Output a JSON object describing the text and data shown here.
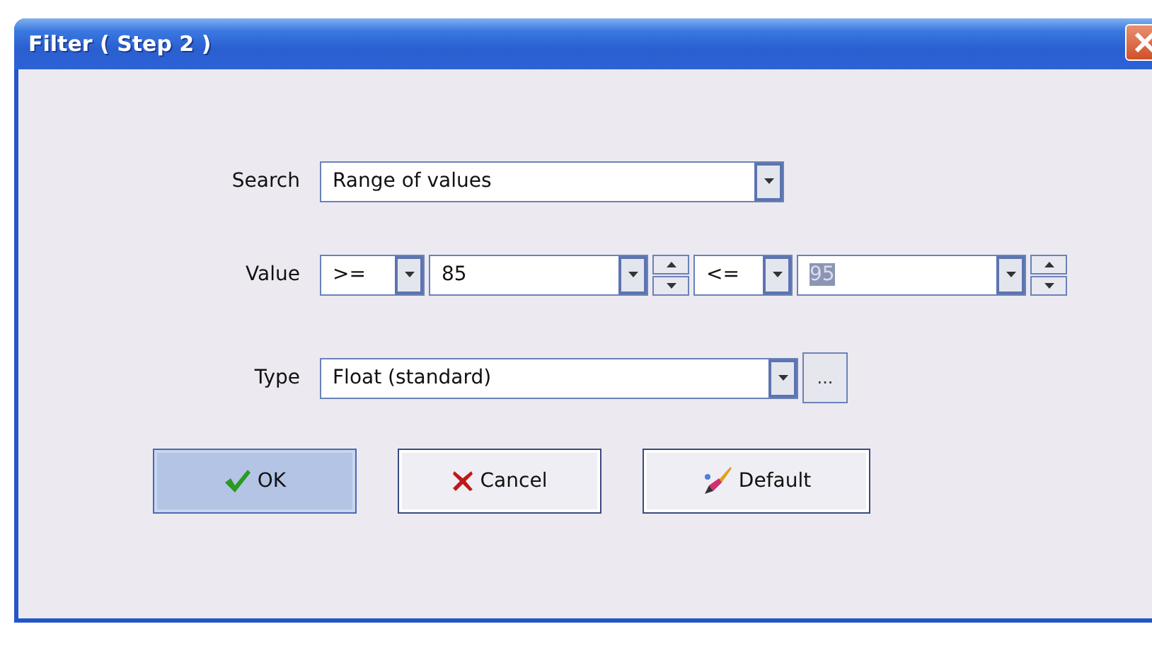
{
  "window": {
    "title": "Filter ( Step 2 )"
  },
  "search": {
    "label": "Search",
    "value": "Range of values"
  },
  "value": {
    "label": "Value",
    "from": {
      "operator": ">=",
      "value": "85",
      "text_selected": false
    },
    "to": {
      "operator": "<=",
      "value": "95",
      "text_selected": true
    }
  },
  "type": {
    "label": "Type",
    "value": "Float (standard)",
    "more": "..."
  },
  "buttons": [
    {
      "kind": "ok",
      "label": "OK",
      "default": true
    },
    {
      "kind": "cancel",
      "label": "Cancel",
      "default": false
    },
    {
      "kind": "default",
      "label": "Default",
      "default": false
    }
  ]
}
